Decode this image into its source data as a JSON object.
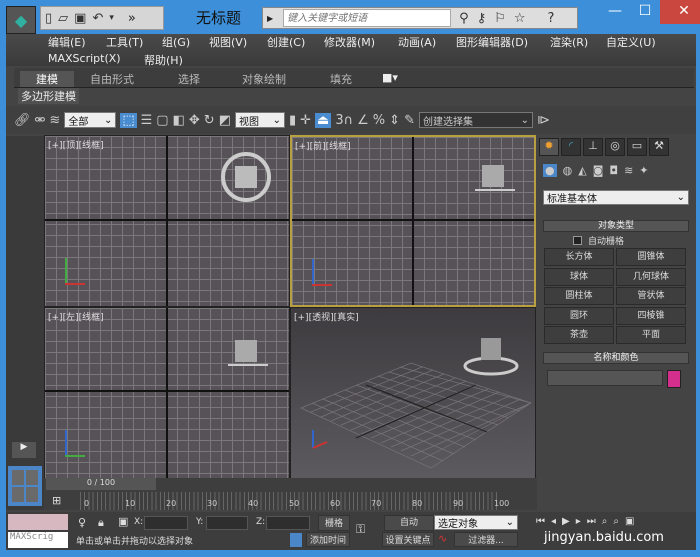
{
  "window": {
    "title": "无标题",
    "search_placeholder": "键入关键字或短语",
    "minimize": "—",
    "maximize": "☐",
    "close": "✕"
  },
  "quick_access": {
    "icons": [
      "new-file-icon",
      "open-folder-icon",
      "save-icon",
      "undo-icon"
    ],
    "more": "»"
  },
  "menubar": {
    "items": [
      "编辑(E)",
      "工具(T)",
      "组(G)",
      "视图(V)",
      "创建(C)",
      "修改器(M)",
      "动画(A)",
      "图形编辑器(D)",
      "渲染(R)",
      "自定义(U)",
      "MAXScript(X)",
      "帮助(H)"
    ]
  },
  "ribbon": {
    "tabs": [
      "建模",
      "自由形式",
      "选择",
      "对象绘制",
      "填充"
    ],
    "active_tab": "建模",
    "panel": "多边形建模"
  },
  "toolbar": {
    "selection_filter": "全部",
    "reference_coord": "视图",
    "named_selection": "创建选择集",
    "snap_label": "3"
  },
  "viewports": [
    {
      "label": "[+][顶][线框]"
    },
    {
      "label": "[+][前][线框]",
      "active": true
    },
    {
      "label": "[+][左][线框]"
    },
    {
      "label": "[+][透视][真实]"
    }
  ],
  "command_panel": {
    "category_dropdown": "标准基本体",
    "object_type": {
      "title": "对象类型",
      "autogrid": "自动栅格",
      "autogrid_checked": false,
      "buttons": [
        "长方体",
        "圆锥体",
        "球体",
        "几何球体",
        "圆柱体",
        "管状体",
        "圆环",
        "四棱锥",
        "茶壶",
        "平面"
      ]
    },
    "name_color": {
      "title": "名称和颜色",
      "name_value": "",
      "color": "#d42f8c"
    }
  },
  "timeline": {
    "frame_display": "0 / 100",
    "ticks": [
      "0",
      "10",
      "20",
      "30",
      "40",
      "50",
      "60",
      "70",
      "80",
      "90",
      "100"
    ]
  },
  "status": {
    "maxscript": "MAXScrig",
    "prompt": "单击或单击并拖动以选择对象",
    "add_time_tag": "添加时间",
    "x_label": "X:",
    "y_label": "Y:",
    "z_label": "Z:",
    "grid": "栅格",
    "auto_key": "自动",
    "set_key": "设置关键点",
    "key_filter_select": "选定对象",
    "filters": "过滤器...",
    "watermark": "jingyan.baidu.com"
  }
}
